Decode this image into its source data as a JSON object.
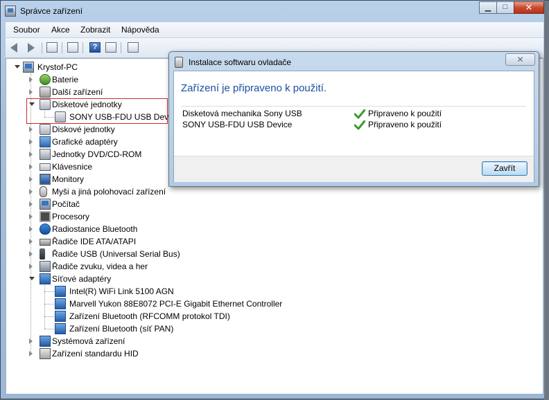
{
  "window": {
    "title": "Správce zařízení",
    "caption": {
      "minimize": "▁",
      "maximize": "□",
      "close": "✕"
    }
  },
  "menu": [
    "Soubor",
    "Akce",
    "Zobrazit",
    "Nápověda"
  ],
  "toolbar": {
    "icons": [
      "back-icon",
      "forward-icon",
      "show-hide-tree-icon",
      "properties-icon",
      "help-icon",
      "view-icon",
      "scan-hardware-icon"
    ]
  },
  "tree": {
    "root": "Krystof-PC",
    "items": [
      {
        "label": "Baterie",
        "icon": "battery-icon",
        "state": "closed"
      },
      {
        "label": "Další zařízení",
        "icon": "other-devices-icon",
        "state": "closed"
      },
      {
        "label": "Disketové jednotky",
        "icon": "floppy-drive-icon",
        "state": "open"
      },
      {
        "label": "SONY USB-FDU USB Device",
        "icon": "floppy-device-icon",
        "state": "child"
      },
      {
        "label": "Diskové jednotky",
        "icon": "disk-drive-icon",
        "state": "closed"
      },
      {
        "label": "Grafické adaptéry",
        "icon": "display-adapter-icon",
        "state": "closed"
      },
      {
        "label": "Jednotky DVD/CD-ROM",
        "icon": "dvd-drive-icon",
        "state": "closed"
      },
      {
        "label": "Klávesnice",
        "icon": "keyboard-icon",
        "state": "closed"
      },
      {
        "label": "Monitory",
        "icon": "monitor-icon",
        "state": "closed"
      },
      {
        "label": "Myši a jiná polohovací zařízení",
        "icon": "mouse-icon",
        "state": "closed"
      },
      {
        "label": "Počítač",
        "icon": "computer-icon",
        "state": "closed"
      },
      {
        "label": "Procesory",
        "icon": "processor-icon",
        "state": "closed"
      },
      {
        "label": "Radiostanice Bluetooth",
        "icon": "bluetooth-icon",
        "state": "closed"
      },
      {
        "label": "Řadiče IDE ATA/ATAPI",
        "icon": "ide-controller-icon",
        "state": "closed"
      },
      {
        "label": "Řadiče USB (Universal Serial Bus)",
        "icon": "usb-icon",
        "state": "closed"
      },
      {
        "label": "Řadiče zvuku, videa a her",
        "icon": "sound-icon",
        "state": "closed"
      },
      {
        "label": "Síťové adaptéry",
        "icon": "network-adapter-icon",
        "state": "open"
      },
      {
        "label": "Intel(R) WiFi Link 5100 AGN",
        "icon": "network-adapter-icon",
        "state": "child"
      },
      {
        "label": "Marvell Yukon 88E8072 PCI-E Gigabit Ethernet Controller",
        "icon": "network-adapter-icon",
        "state": "child"
      },
      {
        "label": "Zařízení Bluetooth (RFCOMM protokol TDI)",
        "icon": "network-adapter-icon",
        "state": "child"
      },
      {
        "label": "Zařízení Bluetooth (síť PAN)",
        "icon": "network-adapter-icon",
        "state": "child"
      },
      {
        "label": "Systémová zařízení",
        "icon": "system-devices-icon",
        "state": "closed"
      },
      {
        "label": "Zařízení standardu HID",
        "icon": "hid-icon",
        "state": "closed"
      }
    ]
  },
  "dialog": {
    "title": "Instalace softwaru ovladače",
    "close_glyph": "✕",
    "heading": "Zařízení je připraveno k použití.",
    "devices": [
      {
        "name": "Disketová mechanika Sony USB",
        "status": "Připraveno k použití"
      },
      {
        "name": "SONY USB-FDU USB Device",
        "status": "Připraveno k použití"
      }
    ],
    "close_button": "Zavřít"
  },
  "colors": {
    "heading_blue": "#1a4fa0",
    "highlight_red": "#d02b2b",
    "check_green": "#3a9a2a"
  }
}
